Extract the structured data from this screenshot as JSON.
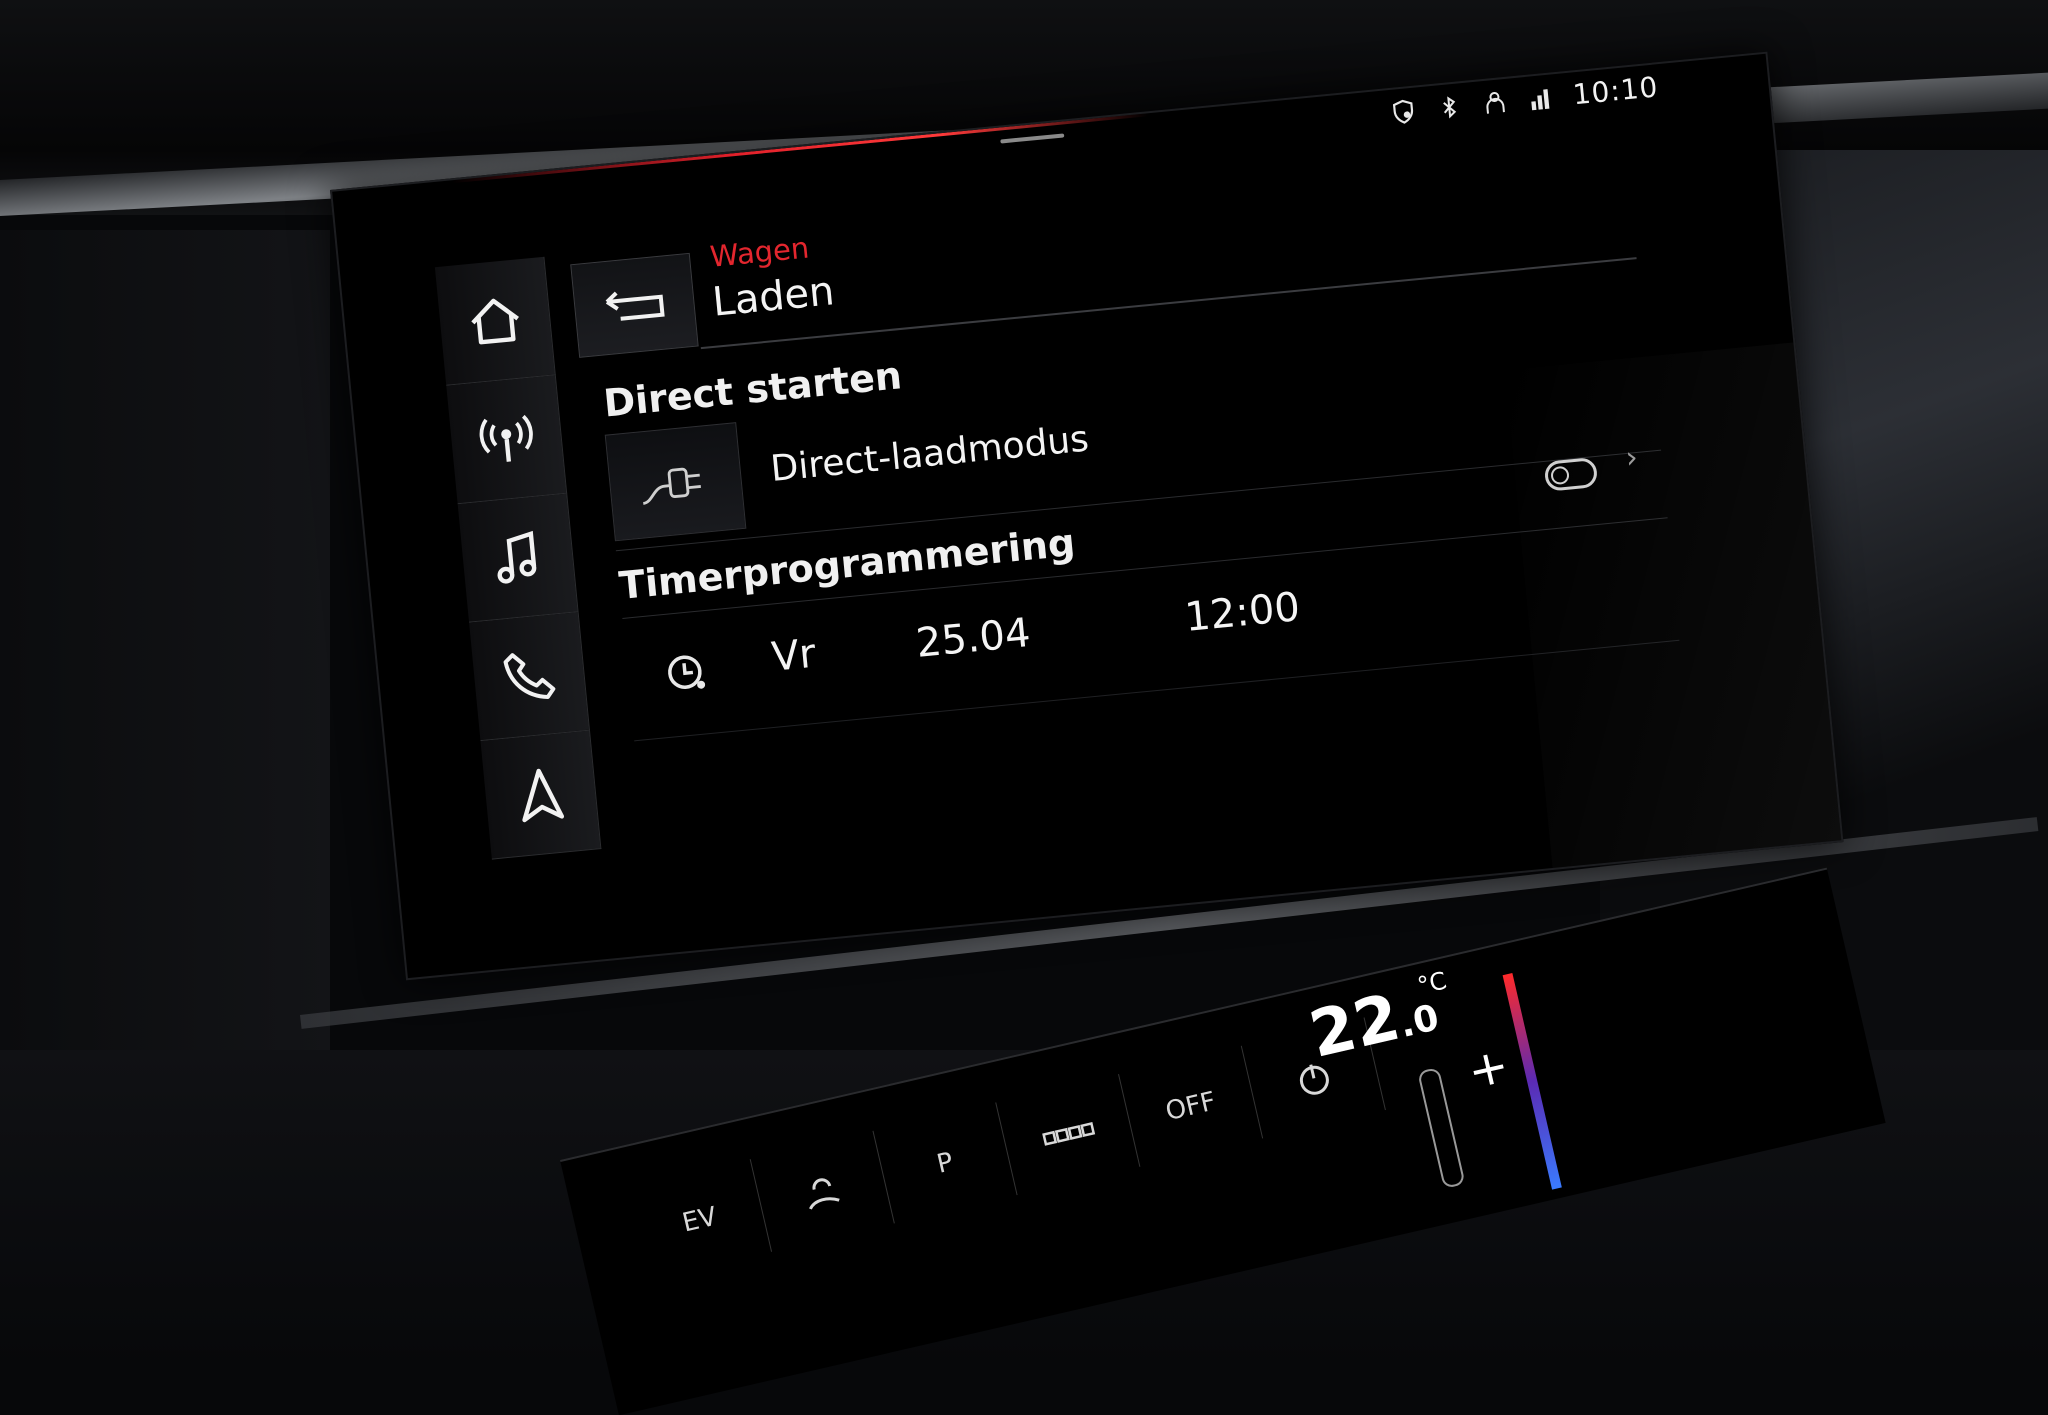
{
  "status_bar": {
    "time": "10:10",
    "icons": [
      "shield-location-icon",
      "bluetooth-icon",
      "person-icon",
      "network-icon"
    ]
  },
  "sidebar": {
    "items": [
      {
        "icon": "home-icon"
      },
      {
        "icon": "radio-icon"
      },
      {
        "icon": "music-icon"
      },
      {
        "icon": "phone-icon"
      },
      {
        "icon": "navigation-icon"
      }
    ]
  },
  "header": {
    "parent": "Wagen",
    "title": "Laden",
    "back_icon": "back-arrow-icon"
  },
  "direct_section": {
    "title": "Direct starten",
    "item_label": "Direct-laadmodus",
    "item_icon": "charging-plug-icon"
  },
  "timer_section": {
    "title": "Timerprogrammering",
    "toggle_state": "off",
    "row": {
      "day": "Vr",
      "date": "25.04",
      "time": "12:00",
      "icon": "timer-clock-icon"
    }
  },
  "climate": {
    "buttons": [
      "EV",
      "",
      "P",
      "",
      "OFF",
      ""
    ],
    "temperature": "22",
    "temperature_decimal": ".0",
    "temperature_unit": "°C",
    "plus_label": "+"
  },
  "colors": {
    "accent": "#e3262e",
    "text": "#f4f4f4",
    "background": "#000000"
  }
}
